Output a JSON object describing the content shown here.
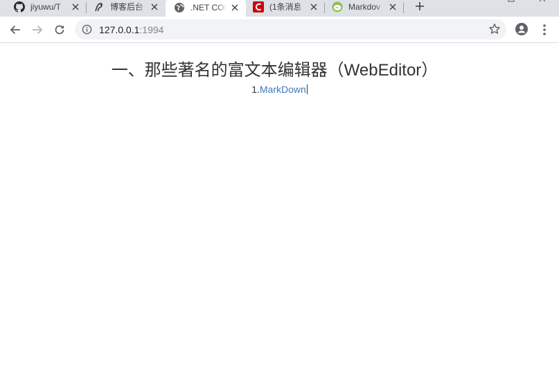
{
  "browser": {
    "tabs": [
      {
        "title": "jiyuwu/T",
        "favicon": "github-icon",
        "active": false
      },
      {
        "title": "博客后台",
        "favicon": "blog-icon",
        "active": false
      },
      {
        "title": ".NET COI",
        "favicon": "globe-icon",
        "active": true
      },
      {
        "title": "(1条消息",
        "favicon": "csdn-icon",
        "active": false
      },
      {
        "title": "Markdov",
        "favicon": "markdown-site-icon",
        "active": false
      }
    ],
    "address": {
      "host": "127.0.0.1",
      "port": ":1994"
    }
  },
  "page": {
    "heading": "一、那些著名的富文本编辑器（WebEditor）",
    "item_number": "1.",
    "item_link": "MarkDown"
  },
  "colors": {
    "tabstrip": "#dee1e6",
    "link": "#3a7bb7",
    "csdn_red": "#c80a0a",
    "markdown_green": "#8bc34a"
  }
}
